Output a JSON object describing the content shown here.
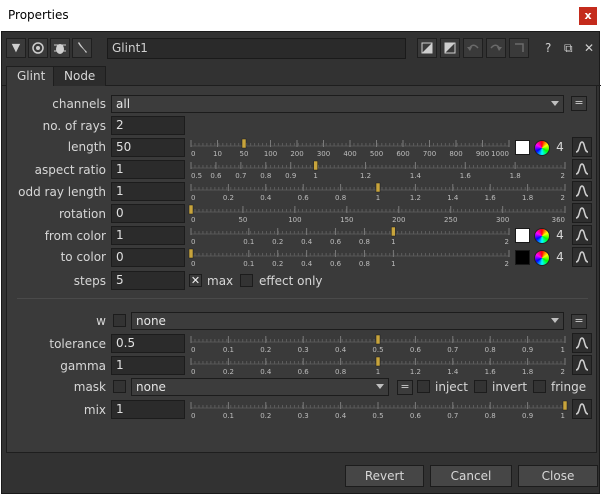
{
  "window": {
    "title": "Properties",
    "close_label": "x"
  },
  "toolbar": {
    "collapse_label": "▼",
    "node_name": "Glint1",
    "help_label": "?",
    "float_label": "⧉",
    "close_label": "✕"
  },
  "tabs": [
    "Glint",
    "Node"
  ],
  "knobs": {
    "channels": {
      "label": "channels",
      "value": "all"
    },
    "rays": {
      "label": "no. of rays",
      "value": "2"
    },
    "length": {
      "label": "length",
      "value": "50",
      "count": "4",
      "swatch": "#ffffff",
      "ticks": [
        "0",
        "10",
        "50",
        "100",
        "200",
        "300",
        "400",
        "500",
        "600",
        "700",
        "800",
        "900",
        "1000"
      ],
      "level": 50
    },
    "aspect": {
      "label": "aspect ratio",
      "value": "1",
      "ticks": [
        "0.5",
        "0.6",
        "0.7",
        "0.8",
        "0.9",
        "1",
        "1.2",
        "1.4",
        "1.6",
        "1.8",
        "2"
      ],
      "level": 1
    },
    "odd": {
      "label": "odd ray length",
      "value": "1",
      "ticks": [
        "0",
        "0.2",
        "0.4",
        "0.6",
        "0.8",
        "1",
        "1.2",
        "1.4",
        "1.6",
        "1.8",
        "2"
      ],
      "level": 1
    },
    "rotation": {
      "label": "rotation",
      "value": "0",
      "ticks": [
        "0",
        "50",
        "100",
        "150",
        "200",
        "250",
        "300",
        "360"
      ],
      "level": 0
    },
    "from_color": {
      "label": "from color",
      "value": "1",
      "count": "4",
      "swatch": "#ffffff",
      "ticks": [
        "0",
        "0.1",
        "0.2",
        "0.4",
        "0.6",
        "0.8",
        "1",
        "2"
      ],
      "level": 1
    },
    "to_color": {
      "label": "to color",
      "value": "0",
      "count": "4",
      "swatch": "#000000",
      "ticks": [
        "0",
        "0.1",
        "0.2",
        "0.4",
        "0.6",
        "0.8",
        "1",
        "2"
      ],
      "level": 0
    },
    "steps": {
      "label": "steps",
      "value": "5",
      "max_label": "max",
      "max_checked": true,
      "effect_only_label": "effect only"
    },
    "w": {
      "label": "w",
      "value": "none"
    },
    "tolerance": {
      "label": "tolerance",
      "value": "0.5",
      "ticks": [
        "0",
        "0.1",
        "0.2",
        "0.3",
        "0.4",
        "0.5",
        "0.6",
        "0.7",
        "0.8",
        "0.9",
        "1"
      ],
      "level": 0.5
    },
    "gamma": {
      "label": "gamma",
      "value": "1",
      "ticks": [
        "0",
        "0.2",
        "0.4",
        "0.6",
        "0.8",
        "1",
        "1.2",
        "1.4",
        "1.6",
        "1.8",
        "2"
      ],
      "level": 1
    },
    "mask": {
      "label": "mask",
      "value": "none",
      "inject_label": "inject",
      "invert_label": "invert",
      "fringe_label": "fringe"
    },
    "mix": {
      "label": "mix",
      "value": "1",
      "ticks": [
        "0",
        "0.1",
        "0.2",
        "0.3",
        "0.4",
        "0.5",
        "0.6",
        "0.7",
        "0.8",
        "0.9",
        "1"
      ],
      "level": 1
    }
  },
  "buttons": {
    "revert": "Revert",
    "cancel": "Cancel",
    "close": "Close"
  },
  "colors": {
    "panel_bg": "#3a3a3a",
    "field_bg": "#2b2b2b",
    "slider_handle": "#c8a43c"
  }
}
